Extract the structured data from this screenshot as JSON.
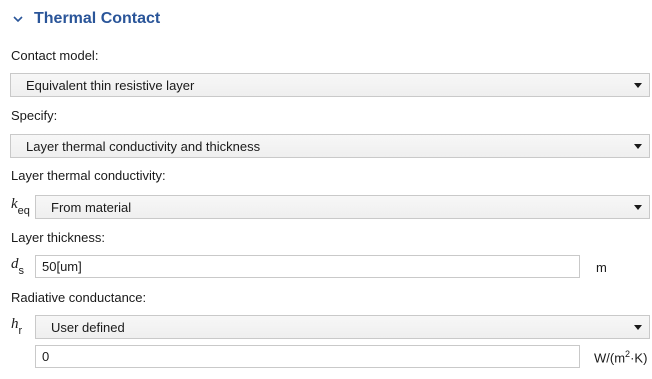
{
  "section": {
    "title": "Thermal Contact",
    "toggle_icon": "chevron-down-icon"
  },
  "contact_model": {
    "label": "Contact model:",
    "value": "Equivalent thin resistive layer"
  },
  "specify": {
    "label": "Specify:",
    "value": "Layer thermal conductivity and thickness"
  },
  "layer_conductivity": {
    "label": "Layer thermal conductivity:",
    "symbol": "k",
    "symbol_sub": "eq",
    "value": "From material"
  },
  "layer_thickness": {
    "label": "Layer thickness:",
    "symbol": "d",
    "symbol_sub": "s",
    "value": "50[um]",
    "unit": "m"
  },
  "radiative_conductance": {
    "label": "Radiative conductance:",
    "symbol": "h",
    "symbol_sub": "r",
    "value": "User defined",
    "input_value": "0",
    "unit_prefix": "W/(m",
    "unit_exp": "2",
    "unit_suffix": "·K)"
  },
  "colors": {
    "title": "#2a5599",
    "border": "#c9c9c9",
    "select_bg": "#f2f2f2"
  }
}
